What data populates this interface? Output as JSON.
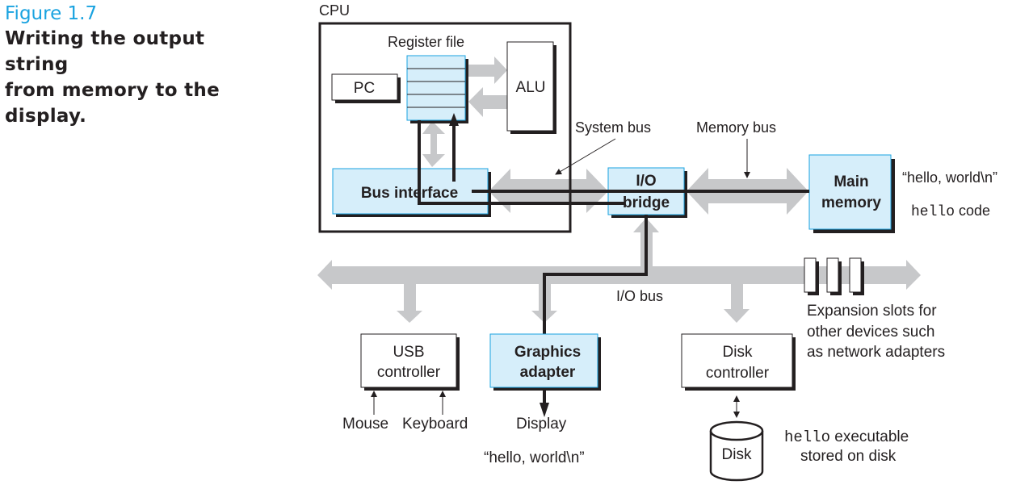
{
  "caption": {
    "figure_number": "Figure 1.7",
    "title_lines": [
      "Writing the output string",
      "from memory to the",
      "display."
    ]
  },
  "colors": {
    "accent_blue": "#1aa3e0",
    "box_fill_blue": "#d6eefa",
    "bus_gray": "#c7c8ca",
    "ink": "#231f20"
  },
  "cpu": {
    "label": "CPU",
    "register_file_label": "Register file",
    "register_rows": 5,
    "pc_label": "PC",
    "alu_label": "ALU",
    "bus_interface_label": "Bus interface"
  },
  "buses": {
    "system_bus_label": "System bus",
    "memory_bus_label": "Memory bus",
    "io_bus_label": "I/O bus"
  },
  "io_bridge": {
    "line1": "I/O",
    "line2": "bridge"
  },
  "main_memory": {
    "line1": "Main",
    "line2": "memory",
    "note_string": "“hello, world\\n”",
    "note_code_mono": "hello",
    "note_code_rest": " code"
  },
  "devices": {
    "usb": {
      "line1": "USB",
      "line2": "controller",
      "inputs": [
        "Mouse",
        "Keyboard"
      ]
    },
    "graphics": {
      "line1": "Graphics",
      "line2": "adapter",
      "output": "Display",
      "output_string": "“hello, world\\n”"
    },
    "disk_controller": {
      "line1": "Disk",
      "line2": "controller"
    },
    "disk": {
      "label": "Disk",
      "note_mono": "hello",
      "note_rest": " executable",
      "note_line2": "stored on disk"
    },
    "expansion": {
      "slot_count": 3,
      "lines": [
        "Expansion slots for",
        "other devices such",
        "as network adapters"
      ]
    }
  }
}
